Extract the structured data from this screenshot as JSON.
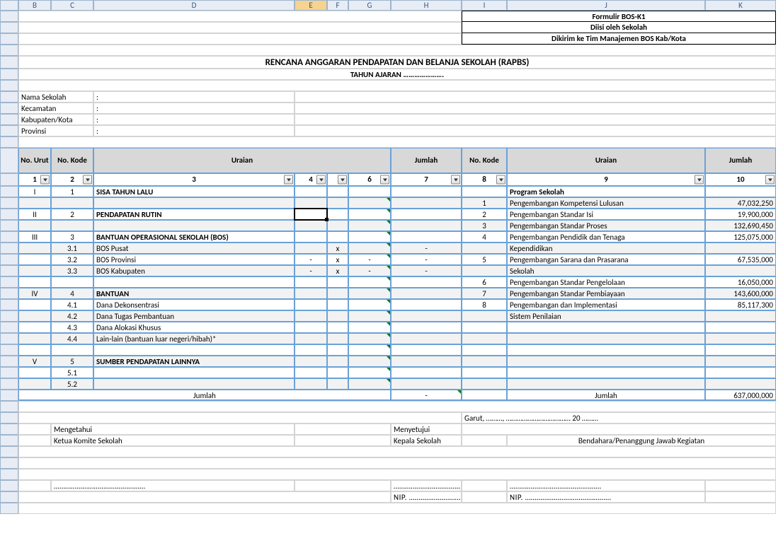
{
  "columns": [
    "",
    "B",
    "C",
    "D",
    "E",
    "F",
    "G",
    "H",
    "I",
    "J",
    "K"
  ],
  "formBox": {
    "line1": "Formulir BOS-K1",
    "line2": "Diisi oleh Sekolah",
    "line3": "Dikirim ke Tim Manajemen BOS Kab/Kota"
  },
  "title": "RENCANA ANGGARAN PENDAPATAN DAN BELANJA SEKOLAH (RAPBS)",
  "subtitle": "TAHUN AJARAN ………………….",
  "meta": {
    "nama_label": "Nama Sekolah",
    "kec_label": "Kecamatan",
    "kab_label": "Kabupaten/Kota",
    "prov_label": "Provinsi",
    "colon": ":"
  },
  "headers": {
    "no_urut": "No. Urut",
    "no_kode": "No. Kode",
    "uraian": "Uraian",
    "jumlah": "Jumlah"
  },
  "colNums": [
    "1",
    "2",
    "3",
    "4",
    "",
    "6",
    "7",
    "8",
    "9",
    "10"
  ],
  "leftRows": [
    {
      "z": false,
      "urut": "I",
      "kode": "1",
      "ur": "SISA TAHUN LALU",
      "bold": true,
      "e": "",
      "f": "",
      "g": "",
      "h": ""
    },
    {
      "z": true,
      "urut": "",
      "kode": "",
      "ur": "",
      "e": "",
      "f": "",
      "g": "",
      "h": "",
      "gtri": true
    },
    {
      "z": false,
      "urut": "II",
      "kode": "2",
      "ur": "PENDAPATAN RUTIN",
      "bold": true,
      "e": "",
      "f": "",
      "g": "",
      "h": "",
      "active": true,
      "gtri": true
    },
    {
      "z": true,
      "urut": "",
      "kode": "",
      "ur": "",
      "e": "",
      "f": "",
      "g": "",
      "h": "",
      "gtri": true
    },
    {
      "z": false,
      "urut": "III",
      "kode": "3",
      "ur": "BANTUAN OPERASIONAL SEKOLAH (BOS)",
      "bold": true,
      "e": "",
      "f": "",
      "g": "",
      "h": "",
      "gtri": true
    },
    {
      "z": true,
      "urut": "",
      "kode": "3.1",
      "ur": "BOS Pusat",
      "e": "",
      "f": "x",
      "g": "",
      "h": "-",
      "gtri": true
    },
    {
      "z": false,
      "urut": "",
      "kode": "3.2",
      "ur": "BOS Provinsi",
      "e": "-",
      "f": "x",
      "g": "-",
      "h": "-",
      "gtri": true
    },
    {
      "z": true,
      "urut": "",
      "kode": "3.3",
      "ur": "BOS Kabupaten",
      "e": "-",
      "f": "x",
      "g": "-",
      "h": "-",
      "gtri": true
    },
    {
      "z": false,
      "urut": "",
      "kode": "",
      "ur": "",
      "e": "",
      "f": "",
      "g": "",
      "h": "",
      "gtri": true
    },
    {
      "z": true,
      "urut": "IV",
      "kode": "4",
      "ur": "BANTUAN",
      "bold": true,
      "e": "",
      "f": "",
      "g": "",
      "h": "",
      "gtri": true
    },
    {
      "z": false,
      "urut": "",
      "kode": "4.1",
      "ur": "Dana Dekonsentrasi",
      "e": "",
      "f": "",
      "g": "",
      "h": "",
      "gtri": true
    },
    {
      "z": true,
      "urut": "",
      "kode": "4.2",
      "ur": "Dana Tugas Pembantuan",
      "e": "",
      "f": "",
      "g": "",
      "h": "",
      "gtri": true
    },
    {
      "z": false,
      "urut": "",
      "kode": "4.3",
      "ur": "Dana Alokasi Khusus",
      "e": "",
      "f": "",
      "g": "",
      "h": "",
      "gtri": true
    },
    {
      "z": true,
      "urut": "",
      "kode": "4.4",
      "ur": "Lain-lain (bantuan luar negeri/hibah)*",
      "e": "",
      "f": "",
      "g": "",
      "h": "",
      "gtri": true
    },
    {
      "z": false,
      "urut": "",
      "kode": "",
      "ur": "",
      "e": "",
      "f": "",
      "g": "",
      "h": "",
      "gtri": true
    },
    {
      "z": true,
      "urut": "V",
      "kode": "5",
      "ur": "SUMBER PENDAPATAN LAINNYA",
      "bold": true,
      "e": "",
      "f": "",
      "g": "",
      "h": "",
      "gtri": true
    },
    {
      "z": false,
      "urut": "",
      "kode": "5.1",
      "ur": "",
      "e": "",
      "f": "",
      "g": "",
      "h": "",
      "gtri": true
    },
    {
      "z": true,
      "urut": "",
      "kode": "5.2",
      "ur": "",
      "e": "",
      "f": "",
      "g": "",
      "h": "",
      "gtri": true
    }
  ],
  "rightRows": [
    {
      "kode": "",
      "ur": "Program Sekolah",
      "bold": true,
      "jml": ""
    },
    {
      "kode": "1",
      "ur": "Pengembangan Kompetensi Lulusan",
      "jml": "47,032,250"
    },
    {
      "kode": "2",
      "ur": "Pengembangan Standar Isi",
      "jml": "19,900,000"
    },
    {
      "kode": "3",
      "ur": "Pengembangan Standar Proses",
      "jml": "132,690,450"
    },
    {
      "kode": "4",
      "ur": "Pengembangan Pendidik dan Tenaga",
      "jml": "125,075,000"
    },
    {
      "kode": "",
      "ur": "Kependidikan",
      "jml": ""
    },
    {
      "kode": "5",
      "ur": "Pengembangan Sarana dan Prasarana",
      "jml": "67,535,000"
    },
    {
      "kode": "",
      "ur": "Sekolah",
      "jml": ""
    },
    {
      "kode": "6",
      "ur": "Pengembangan Standar Pengelolaan",
      "jml": "16,050,000"
    },
    {
      "kode": "7",
      "ur": "Pengembangan Standar Pembiayaan",
      "jml": "143,600,000"
    },
    {
      "kode": "8",
      "ur": "Pengembangan dan Implementasi",
      "jml": "85,117,300"
    },
    {
      "kode": "",
      "ur": "Sistem Penilaian",
      "jml": ""
    },
    {
      "kode": "",
      "ur": "",
      "jml": ""
    },
    {
      "kode": "",
      "ur": "",
      "jml": ""
    },
    {
      "kode": "",
      "ur": "",
      "jml": ""
    },
    {
      "kode": "",
      "ur": "",
      "jml": ""
    },
    {
      "kode": "",
      "ur": "",
      "jml": ""
    },
    {
      "kode": "",
      "ur": "",
      "jml": ""
    }
  ],
  "totals": {
    "label": "Jumlah",
    "left_total": "-",
    "right_total": "637,000,000"
  },
  "footer": {
    "garut": "Garut, ………, ……………………………… 20 ………",
    "mengetahui": "Mengetahui",
    "ketua": "Ketua Komite Sekolah",
    "menyetujui": "Menyetujui",
    "kepala": "Kepala Sekolah",
    "bendahara": "Bendahara/Penanggung Jawab Kegiatan",
    "dots": "…………………………………………",
    "nip": "NIP. ………………………………………"
  }
}
